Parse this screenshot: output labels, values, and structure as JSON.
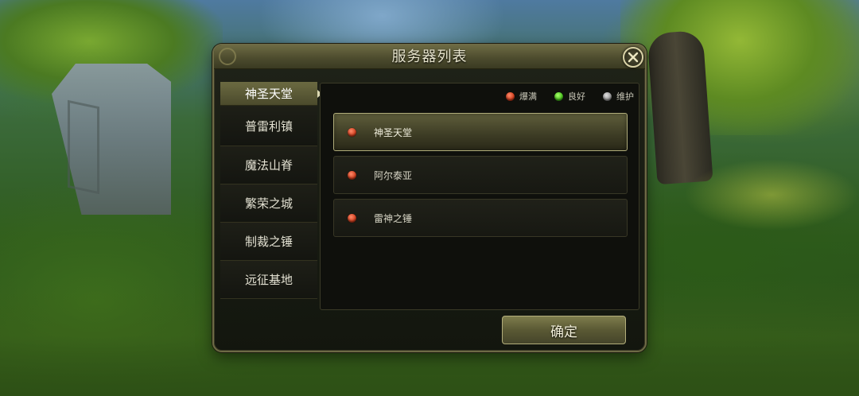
{
  "dialog": {
    "title": "服务器列表",
    "confirm_label": "确定",
    "close_icon": "close-icon"
  },
  "tabs": [
    {
      "label": "神圣天堂",
      "active": true
    },
    {
      "label": "普雷利镇",
      "active": false
    },
    {
      "label": "魔法山脊",
      "active": false
    },
    {
      "label": "繁荣之城",
      "active": false
    },
    {
      "label": "制裁之锤",
      "active": false
    },
    {
      "label": "远征基地",
      "active": false
    }
  ],
  "legend": [
    {
      "label": "爆满",
      "color": "#d2401f",
      "status": "full"
    },
    {
      "label": "良好",
      "color": "#49c21e",
      "status": "good"
    },
    {
      "label": "维护",
      "color": "#999999",
      "status": "maintenance"
    }
  ],
  "servers": [
    {
      "name": "神圣天堂",
      "status": "full",
      "selected": true
    },
    {
      "name": "阿尔泰亚",
      "status": "full",
      "selected": false
    },
    {
      "name": "雷神之锤",
      "status": "full",
      "selected": false
    }
  ]
}
